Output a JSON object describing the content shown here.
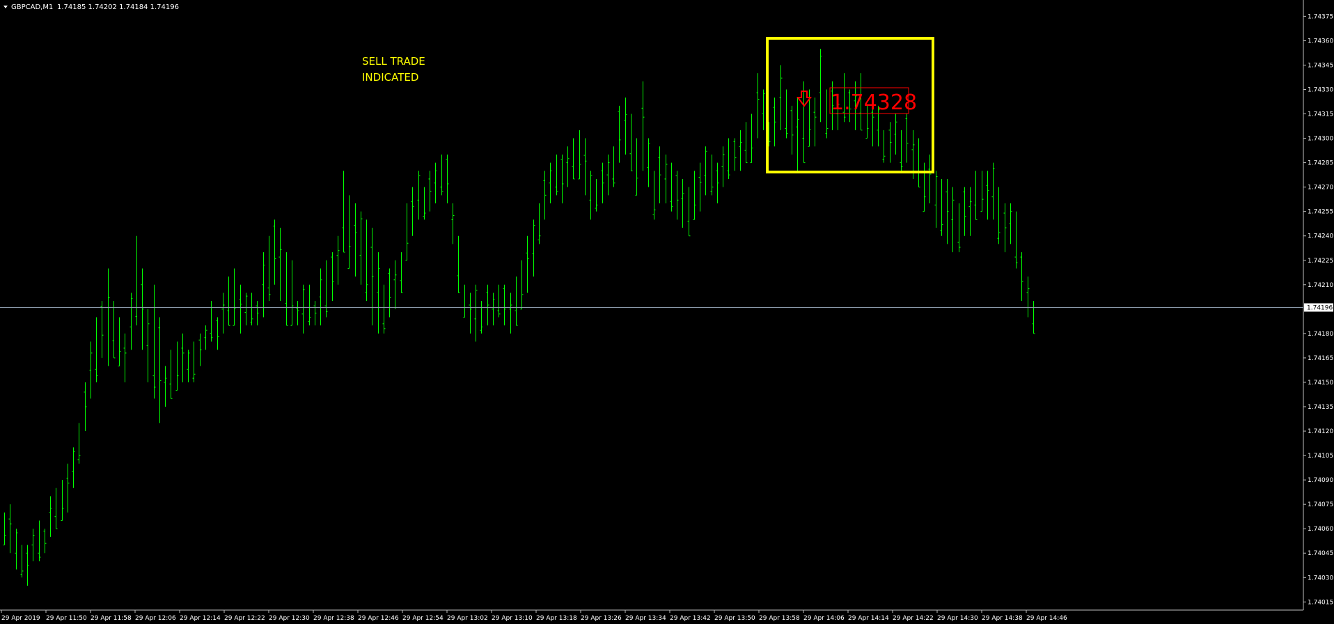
{
  "header": {
    "symbol_label": "GBPCAD,M1",
    "ohlc_text": "1.74185 1.74202 1.74184 1.74196",
    "dropdown_icon": "triangle-down-icon"
  },
  "annotations": {
    "sell_line1": "SELL TRADE",
    "sell_line2": "INDICATED",
    "price_label": "1.74328",
    "arrow_icon": "arrow-down-icon"
  },
  "colors": {
    "background": "#000000",
    "candle": "#00ff00",
    "axis": "#c0c0c0",
    "text": "#ffffff",
    "sell_text": "#ffff00",
    "box": "#ffff00",
    "price_label": "#ff0000",
    "current_line": "#8a9aaa"
  },
  "chart_data": {
    "type": "bar",
    "symbol": "GBPCAD",
    "timeframe": "M1",
    "ylim": [
      1.7401,
      1.74385
    ],
    "y_ticks": [
      1.74015,
      1.7403,
      1.74045,
      1.7406,
      1.74075,
      1.7409,
      1.74105,
      1.7412,
      1.74135,
      1.7415,
      1.74165,
      1.7418,
      1.74196,
      1.7421,
      1.74225,
      1.7424,
      1.74255,
      1.7427,
      1.74285,
      1.743,
      1.74315,
      1.7433,
      1.74345,
      1.7436,
      1.74375
    ],
    "y_tick_labels": [
      "1.74015",
      "1.74030",
      "1.74045",
      "1.74060",
      "1.74075",
      "1.74090",
      "1.74105",
      "1.74120",
      "1.74135",
      "1.74150",
      "1.74165",
      "1.74180",
      "1.74196",
      "1.74210",
      "1.74225",
      "1.74240",
      "1.74255",
      "1.74270",
      "1.74285",
      "1.74300",
      "1.74315",
      "1.74330",
      "1.74345",
      "1.74360",
      "1.74375"
    ],
    "current_price": 1.74196,
    "current_price_label": "1.74196",
    "x_tick_labels": [
      "29 Apr 2019",
      "29 Apr 11:50",
      "29 Apr 11:58",
      "29 Apr 12:06",
      "29 Apr 12:14",
      "29 Apr 12:22",
      "29 Apr 12:30",
      "29 Apr 12:38",
      "29 Apr 12:46",
      "29 Apr 12:54",
      "29 Apr 13:02",
      "29 Apr 13:10",
      "29 Apr 13:18",
      "29 Apr 13:26",
      "29 Apr 13:34",
      "29 Apr 13:42",
      "29 Apr 13:50",
      "29 Apr 13:58",
      "29 Apr 14:06",
      "29 Apr 14:14",
      "29 Apr 14:22",
      "29 Apr 14:30",
      "29 Apr 14:38",
      "29 Apr 14:46"
    ],
    "highs": [
      1.7407,
      1.74075,
      1.7406,
      1.7405,
      1.7405,
      1.7406,
      1.74065,
      1.7406,
      1.7408,
      1.74085,
      1.7409,
      1.741,
      1.7411,
      1.74125,
      1.7415,
      1.74175,
      1.7419,
      1.742,
      1.7422,
      1.742,
      1.7419,
      1.7418,
      1.74205,
      1.7424,
      1.7422,
      1.74195,
      1.7421,
      1.7419,
      1.7416,
      1.7417,
      1.74175,
      1.7418,
      1.7417,
      1.74175,
      1.7418,
      1.74185,
      1.742,
      1.7419,
      1.74205,
      1.74215,
      1.7422,
      1.7421,
      1.74205,
      1.74205,
      1.742,
      1.7423,
      1.7424,
      1.7425,
      1.74245,
      1.7423,
      1.74225,
      1.742,
      1.7421,
      1.7421,
      1.742,
      1.7422,
      1.74225,
      1.7423,
      1.7424,
      1.7428,
      1.74265,
      1.7426,
      1.74255,
      1.7425,
      1.74245,
      1.7423,
      1.7421,
      1.7422,
      1.74225,
      1.7423,
      1.7426,
      1.7427,
      1.7428,
      1.7427,
      1.7428,
      1.74285,
      1.7429,
      1.7429,
      1.7426,
      1.7424,
      1.7421,
      1.74205,
      1.7421,
      1.742,
      1.7421,
      1.74205,
      1.7421,
      1.7421,
      1.74205,
      1.74215,
      1.74225,
      1.7424,
      1.7425,
      1.7426,
      1.7428,
      1.74285,
      1.7429,
      1.7429,
      1.74295,
      1.743,
      1.74305,
      1.743,
      1.7428,
      1.74275,
      1.74285,
      1.7429,
      1.74295,
      1.7432,
      1.74325,
      1.74315,
      1.743,
      1.74335,
      1.743,
      1.7428,
      1.74295,
      1.7429,
      1.74285,
      1.7428,
      1.74275,
      1.7427,
      1.7428,
      1.74285,
      1.74295,
      1.7429,
      1.74285,
      1.74295,
      1.743,
      1.743,
      1.74305,
      1.7431,
      1.74315,
      1.7434,
      1.7433,
      1.7431,
      1.74325,
      1.74345,
      1.7433,
      1.7432,
      1.74325,
      1.74335,
      1.7433,
      1.74325,
      1.74355,
      1.7433,
      1.74335,
      1.74325,
      1.7434,
      1.7433,
      1.74335,
      1.7434,
      1.7432,
      1.74325,
      1.7432,
      1.74305,
      1.7431,
      1.74315,
      1.74305,
      1.74315,
      1.74305,
      1.743,
      1.74285,
      1.7429,
      1.7428,
      1.74275,
      1.74275,
      1.7427,
      1.7426,
      1.7427,
      1.7427,
      1.7428,
      1.7428,
      1.7428,
      1.74285,
      1.7427,
      1.7426,
      1.7426,
      1.74255,
      1.7423,
      1.74215,
      1.742
    ],
    "lows": [
      1.7405,
      1.74045,
      1.74035,
      1.7403,
      1.74025,
      1.7404,
      1.7404,
      1.74045,
      1.74055,
      1.7406,
      1.74065,
      1.7407,
      1.74085,
      1.741,
      1.7412,
      1.7414,
      1.7415,
      1.74165,
      1.7416,
      1.74165,
      1.7416,
      1.7415,
      1.7417,
      1.74185,
      1.7417,
      1.7415,
      1.7414,
      1.74125,
      1.74135,
      1.7414,
      1.74145,
      1.7415,
      1.7415,
      1.7415,
      1.7416,
      1.7417,
      1.74175,
      1.7417,
      1.7418,
      1.74185,
      1.74185,
      1.7418,
      1.74185,
      1.74185,
      1.74185,
      1.7419,
      1.742,
      1.7421,
      1.742,
      1.74185,
      1.74185,
      1.74185,
      1.7418,
      1.74185,
      1.74185,
      1.74185,
      1.7419,
      1.742,
      1.7421,
      1.7423,
      1.7422,
      1.74215,
      1.7421,
      1.742,
      1.74185,
      1.7418,
      1.7418,
      1.7419,
      1.74195,
      1.74205,
      1.74225,
      1.7424,
      1.7425,
      1.7425,
      1.74255,
      1.7426,
      1.74265,
      1.7426,
      1.74235,
      1.74205,
      1.7419,
      1.7418,
      1.74175,
      1.7418,
      1.74185,
      1.74185,
      1.7419,
      1.74185,
      1.7418,
      1.74185,
      1.74195,
      1.74205,
      1.74215,
      1.74235,
      1.7425,
      1.7426,
      1.74265,
      1.7426,
      1.7427,
      1.74275,
      1.74275,
      1.74265,
      1.7425,
      1.74255,
      1.7426,
      1.74265,
      1.7427,
      1.74285,
      1.7429,
      1.7428,
      1.74265,
      1.7428,
      1.7427,
      1.7425,
      1.7426,
      1.7426,
      1.74255,
      1.7425,
      1.74245,
      1.7424,
      1.7425,
      1.74255,
      1.74265,
      1.74265,
      1.7426,
      1.7427,
      1.74275,
      1.7428,
      1.7428,
      1.74285,
      1.74285,
      1.743,
      1.74305,
      1.74295,
      1.74295,
      1.74305,
      1.743,
      1.7429,
      1.7428,
      1.74285,
      1.74295,
      1.74295,
      1.7431,
      1.743,
      1.74305,
      1.74305,
      1.7431,
      1.7431,
      1.74305,
      1.74305,
      1.743,
      1.74295,
      1.74295,
      1.74285,
      1.74285,
      1.7429,
      1.7428,
      1.74285,
      1.74275,
      1.7427,
      1.74255,
      1.7426,
      1.74245,
      1.7424,
      1.74235,
      1.7423,
      1.7423,
      1.7424,
      1.7424,
      1.7425,
      1.74255,
      1.7425,
      1.7425,
      1.74235,
      1.7423,
      1.74235,
      1.7422,
      1.742,
      1.7419,
      1.7418
    ]
  }
}
